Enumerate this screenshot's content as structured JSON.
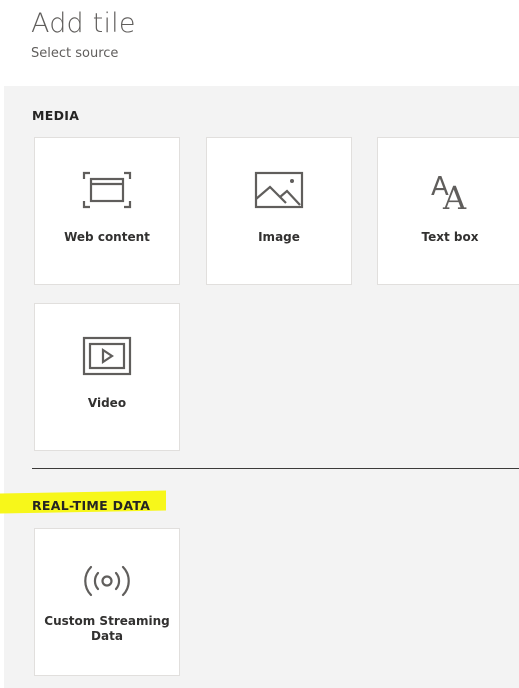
{
  "header": {
    "title": "Add tile",
    "subtitle": "Select source"
  },
  "sections": {
    "media": {
      "title": "MEDIA",
      "tiles": [
        {
          "label": "Web content",
          "icon": "web-content-icon"
        },
        {
          "label": "Image",
          "icon": "image-icon"
        },
        {
          "label": "Text box",
          "icon": "text-box-icon"
        },
        {
          "label": "Video",
          "icon": "video-icon"
        }
      ]
    },
    "realtime": {
      "title": "REAL-TIME DATA",
      "highlight_color": "#f7f71a",
      "tiles": [
        {
          "label": "Custom Streaming Data",
          "icon": "streaming-icon"
        }
      ]
    }
  },
  "colors": {
    "panel_bg": "#f3f3f3",
    "tile_bg": "#ffffff",
    "icon": "#605e5c",
    "text": "#323130"
  }
}
